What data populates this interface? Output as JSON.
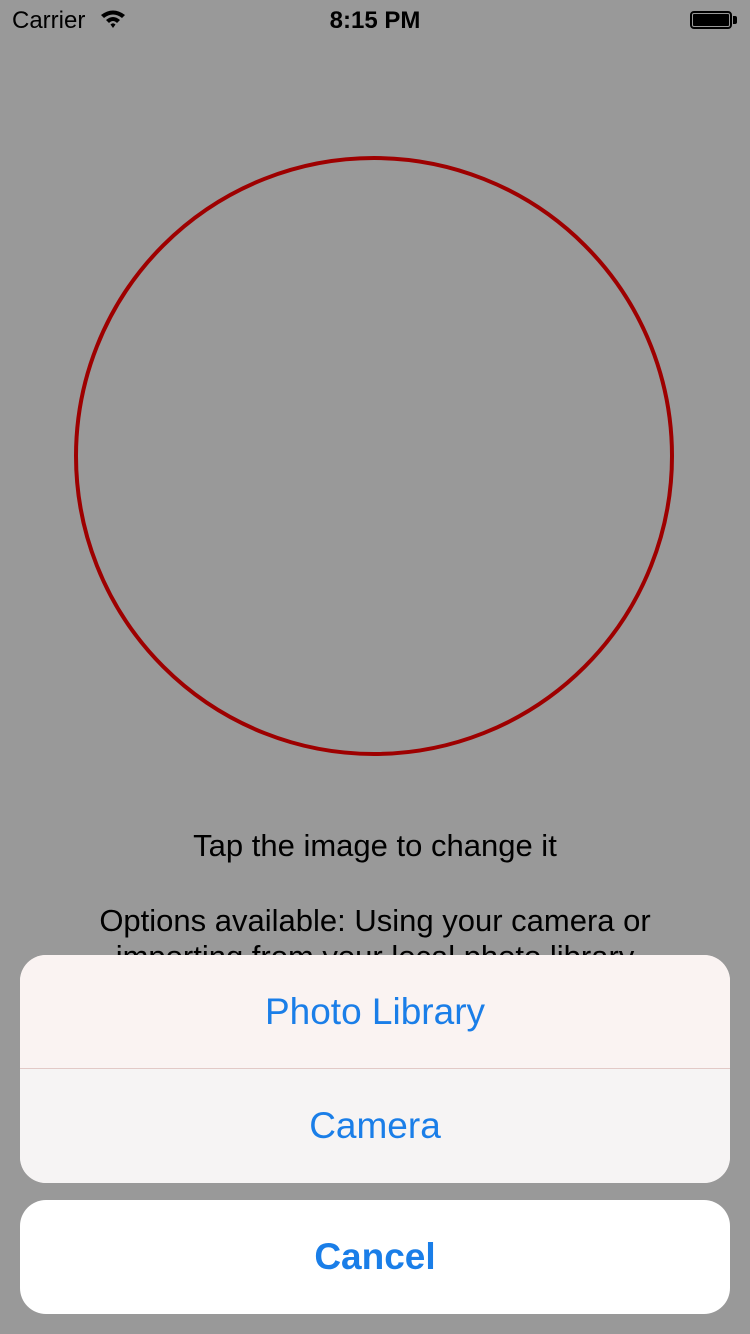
{
  "status_bar": {
    "carrier": "Carrier",
    "time": "8:15 PM",
    "wifi_icon": "wifi-icon",
    "battery_icon": "battery-icon"
  },
  "main": {
    "caption": "Tap the image to change it",
    "options_text": "Options available: Using your camera or importing from your local photo library"
  },
  "action_sheet": {
    "items": [
      {
        "label": "Photo Library"
      },
      {
        "label": "Camera"
      }
    ],
    "cancel_label": "Cancel"
  },
  "colors": {
    "background": "#999999",
    "ring": "#9e0000",
    "accent": "#1a7ee8"
  }
}
